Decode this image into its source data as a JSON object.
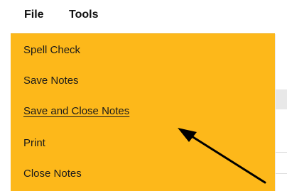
{
  "menubar": {
    "items": [
      {
        "label": "File"
      },
      {
        "label": "Tools"
      }
    ]
  },
  "dropdown": {
    "items": [
      {
        "label": "Spell Check"
      },
      {
        "label": "Save Notes"
      },
      {
        "label": "Save and Close Notes",
        "highlighted": true
      },
      {
        "label": "Print"
      },
      {
        "label": "Close Notes"
      }
    ],
    "background_color": "#fdb81a"
  },
  "annotation": {
    "icon": "arrow-pointer-icon",
    "color": "#000000"
  }
}
